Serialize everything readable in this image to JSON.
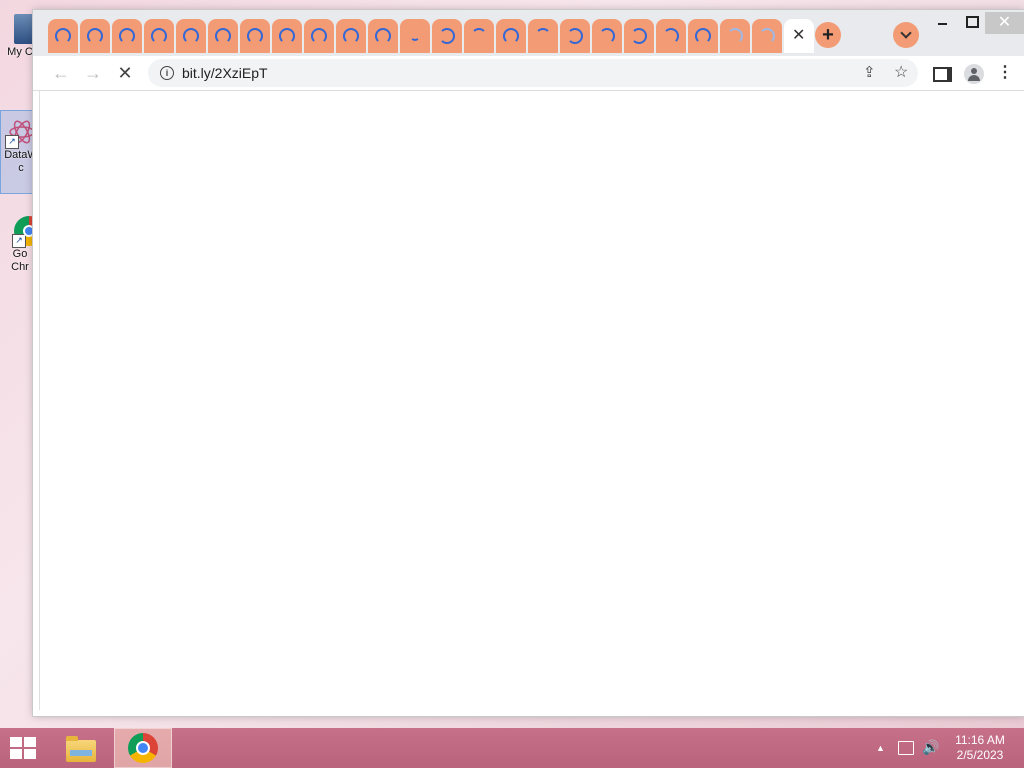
{
  "desktop": {
    "icons": [
      {
        "label": "My C",
        "name": "my-computer"
      },
      {
        "label": "DataW",
        "sublabel": "c",
        "name": "dataw"
      },
      {
        "label": "Go",
        "sublabel": "Chr",
        "name": "google-chrome"
      }
    ]
  },
  "browser": {
    "tab_count": 23,
    "active_tab_close": "✕",
    "new_tab": "+",
    "omnibox": {
      "url": "bit.ly/2XziEpT",
      "info": "i"
    },
    "nav": {
      "back": "←",
      "forward": "→",
      "stop": "✕"
    },
    "menu": "⋮",
    "window": {
      "minimize": "",
      "maximize": "",
      "close": "✕"
    },
    "accent_color": "#f29b74"
  },
  "taskbar": {
    "apps": [
      {
        "name": "file-explorer"
      },
      {
        "name": "google-chrome",
        "active": true
      }
    ],
    "clock": {
      "time": "11:16 AM",
      "date": "2/5/2023"
    }
  }
}
